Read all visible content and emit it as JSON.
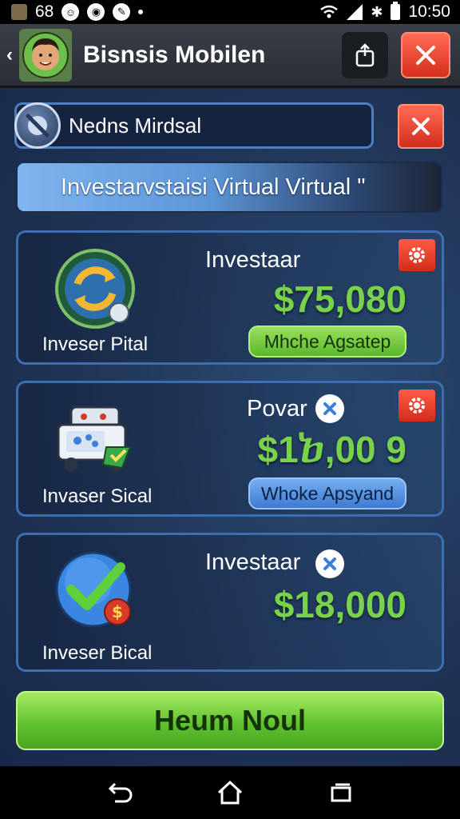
{
  "status_bar": {
    "left_text": "68",
    "time": "10:50",
    "icons": [
      "app-icon",
      "notification-icon",
      "face-icon",
      "edit-icon",
      "dot-icon",
      "wifi-icon",
      "signal-icon",
      "bluetooth-icon",
      "battery-icon"
    ]
  },
  "app_bar": {
    "title": "Bisnsis Mobilen",
    "back_icon": "chevron-left-icon",
    "avatar_icon": "avatar-icon",
    "share_icon": "share-icon",
    "close_icon": "close-icon",
    "close_color": "#e8402c"
  },
  "search": {
    "text": "Nedns Mirdsal",
    "badge_icon": "crossed-circle-icon"
  },
  "banner": {
    "text": "Investarvstaisi Virtual Virtual \""
  },
  "cards": [
    {
      "label": "Investaar",
      "amount": "$75,080",
      "caption": "Inveser Pital",
      "button": "Mhche Agsatep",
      "button_style": "green",
      "icon": "refresh-coin-icon",
      "has_gear": true
    },
    {
      "label": "Povar",
      "amount": "$1ⴆ,00 9",
      "caption": "Invaser Sical",
      "button": "Whoke Apsyand",
      "button_style": "blue",
      "icon": "truck-icon",
      "has_gear": true,
      "has_x_badge": true
    },
    {
      "label": "Investaar",
      "amount": "$18,000",
      "caption": "Inveser Bical",
      "icon": "checkmark-dollar-icon",
      "has_x_badge": true
    }
  ],
  "primary_button": {
    "label": "Heum Noul"
  },
  "nav_bar": {
    "icons": [
      "back-nav-icon",
      "home-icon",
      "recents-icon"
    ]
  },
  "colors": {
    "accent_green": "#79d34a",
    "panel_blue": "#1f3456",
    "border_blue": "#3d6fb0",
    "danger_red": "#e8402c"
  }
}
